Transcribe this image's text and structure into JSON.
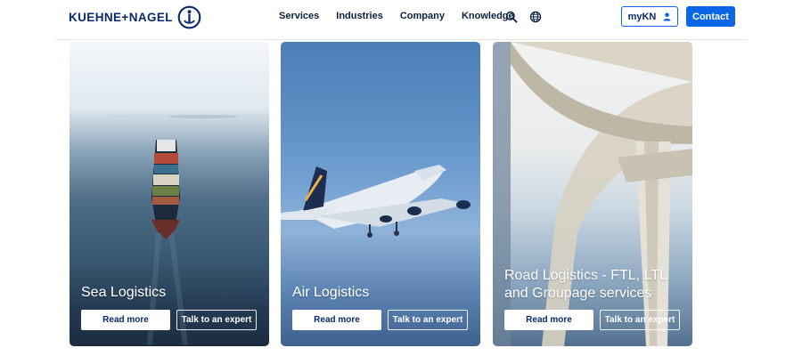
{
  "brand": {
    "name": "KUEHNE+NAGEL",
    "accent": "#0a66e4",
    "navy": "#0a2a6b"
  },
  "nav": {
    "items": [
      "Services",
      "Industries",
      "Company",
      "Knowledge"
    ]
  },
  "header": {
    "search_icon": "search-icon",
    "globe_icon": "globe-icon",
    "mykn_label": "myKN",
    "mykn_icon": "user-icon",
    "contact_label": "Contact"
  },
  "cards": [
    {
      "title": "Sea Logistics",
      "read_more": "Read more",
      "talk": "Talk to an expert"
    },
    {
      "title": "Air Logistics",
      "read_more": "Read more",
      "talk": "Talk to an expert"
    },
    {
      "title": "Road Logistics - FTL, LTL and Groupage services",
      "read_more": "Read more",
      "talk": "Talk to an expert"
    }
  ]
}
